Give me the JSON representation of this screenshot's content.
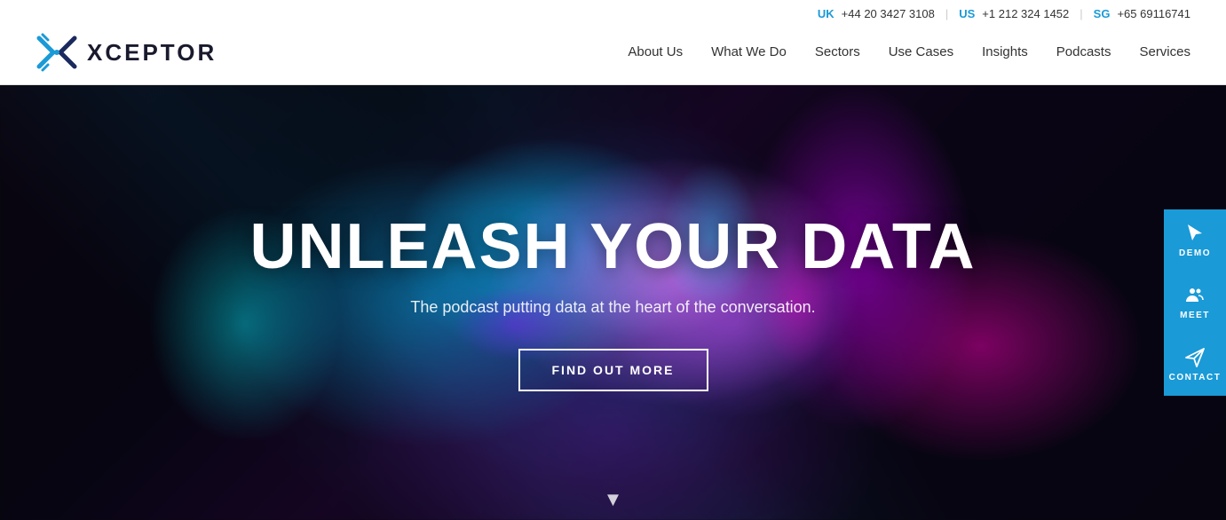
{
  "header": {
    "logo_text": "XCEPTOR",
    "uk_label": "UK",
    "uk_phone": "+44 20 3427 3108",
    "us_label": "US",
    "us_phone": "+1 212 324 1452",
    "sg_label": "SG",
    "sg_phone": "+65 69116741"
  },
  "nav": {
    "items": [
      {
        "label": "About Us",
        "id": "about-us"
      },
      {
        "label": "What We Do",
        "id": "what-we-do"
      },
      {
        "label": "Sectors",
        "id": "sectors"
      },
      {
        "label": "Use Cases",
        "id": "use-cases"
      },
      {
        "label": "Insights",
        "id": "insights"
      },
      {
        "label": "Podcasts",
        "id": "podcasts"
      },
      {
        "label": "Services",
        "id": "services"
      }
    ]
  },
  "hero": {
    "title": "UNLEASH YOUR DATA",
    "subtitle": "The podcast putting data at the heart of the conversation.",
    "cta_label": "FIND OUT MORE"
  },
  "sidebar": {
    "buttons": [
      {
        "label": "DEMO",
        "id": "demo",
        "icon": "cursor"
      },
      {
        "label": "MEET",
        "id": "meet",
        "icon": "people"
      },
      {
        "label": "CONTACT",
        "id": "contact",
        "icon": "paper-plane"
      }
    ]
  }
}
